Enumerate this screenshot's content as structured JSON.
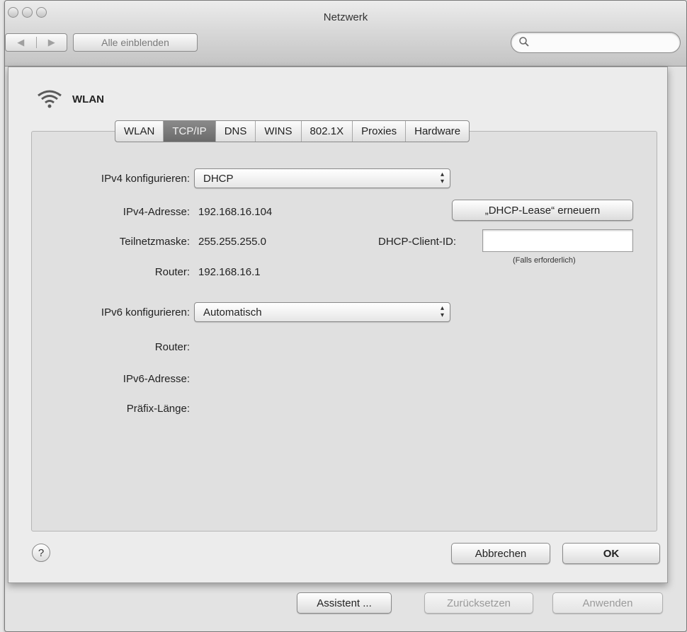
{
  "window": {
    "title": "Netzwerk"
  },
  "toolbar": {
    "show_all_label": "Alle einblenden",
    "back_glyph": "◀",
    "forward_glyph": "▶"
  },
  "service": {
    "name": "WLAN"
  },
  "tabs": [
    {
      "label": "WLAN",
      "active": false
    },
    {
      "label": "TCP/IP",
      "active": true
    },
    {
      "label": "DNS",
      "active": false
    },
    {
      "label": "WINS",
      "active": false
    },
    {
      "label": "802.1X",
      "active": false
    },
    {
      "label": "Proxies",
      "active": false
    },
    {
      "label": "Hardware",
      "active": false
    }
  ],
  "ipv4": {
    "configure_label": "IPv4 konfigurieren:",
    "configure_value": "DHCP",
    "address_label": "IPv4-Adresse:",
    "address_value": "192.168.16.104",
    "subnet_label": "Teilnetzmaske:",
    "subnet_value": "255.255.255.0",
    "router_label": "Router:",
    "router_value": "192.168.16.1",
    "renew_button": "„DHCP-Lease“ erneuern",
    "client_id_label": "DHCP-Client-ID:",
    "client_id_value": "",
    "client_id_hint": "(Falls erforderlich)"
  },
  "ipv6": {
    "configure_label": "IPv6 konfigurieren:",
    "configure_value": "Automatisch",
    "router_label": "Router:",
    "address_label": "IPv6-Adresse:",
    "prefix_label": "Präfix-Länge:"
  },
  "sheet_buttons": {
    "cancel": "Abbrechen",
    "ok": "OK",
    "help": "?"
  },
  "bottom_buttons": {
    "assistant": "Assistent ...",
    "revert": "Zurücksetzen",
    "apply": "Anwenden"
  }
}
